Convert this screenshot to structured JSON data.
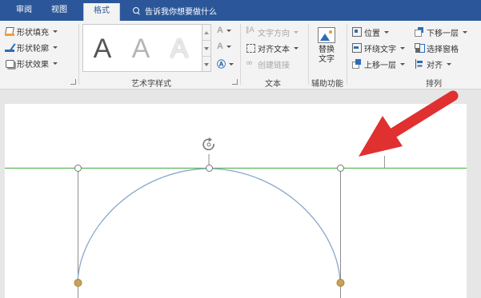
{
  "tabs": [
    {
      "label": "审阅",
      "active": false
    },
    {
      "label": "视图",
      "active": false
    },
    {
      "label": "格式",
      "active": true
    }
  ],
  "tell_me": {
    "placeholder": "告诉我你想要做什么"
  },
  "ribbon": {
    "shape_styles": {
      "fill_label": "形状填充",
      "outline_label": "形状轮廓",
      "effects_label": "形状效果"
    },
    "wordart": {
      "gallery_items": [
        "A",
        "A",
        "A"
      ],
      "group_label": "艺术字样式"
    },
    "text": {
      "direction_label": "文字方向",
      "align_label": "对齐文本",
      "link_label": "创建链接",
      "group_label": "文本"
    },
    "accessibility": {
      "alt_text_label_line1": "替换",
      "alt_text_label_line2": "文字",
      "group_label": "辅助功能"
    },
    "arrange": {
      "position_label": "位置",
      "wrap_label": "环绕文字",
      "forward_label": "上移一层",
      "backward_label": "下移一层",
      "selection_pane_label": "选择窗格",
      "align_label": "对齐",
      "group_label": "排列"
    }
  },
  "colors": {
    "title_bar": "#2b579a",
    "ribbon_bg": "#f3f3f3",
    "guide_line": "#5cb85c",
    "arc_stroke": "#8aa8c8",
    "handle_fill": "#c9a055",
    "arrow": "#e03030"
  },
  "icons": {
    "search": "magnifier-icon",
    "rotate": "rotate-handle-icon",
    "arrow": "red-pointer-arrow"
  }
}
